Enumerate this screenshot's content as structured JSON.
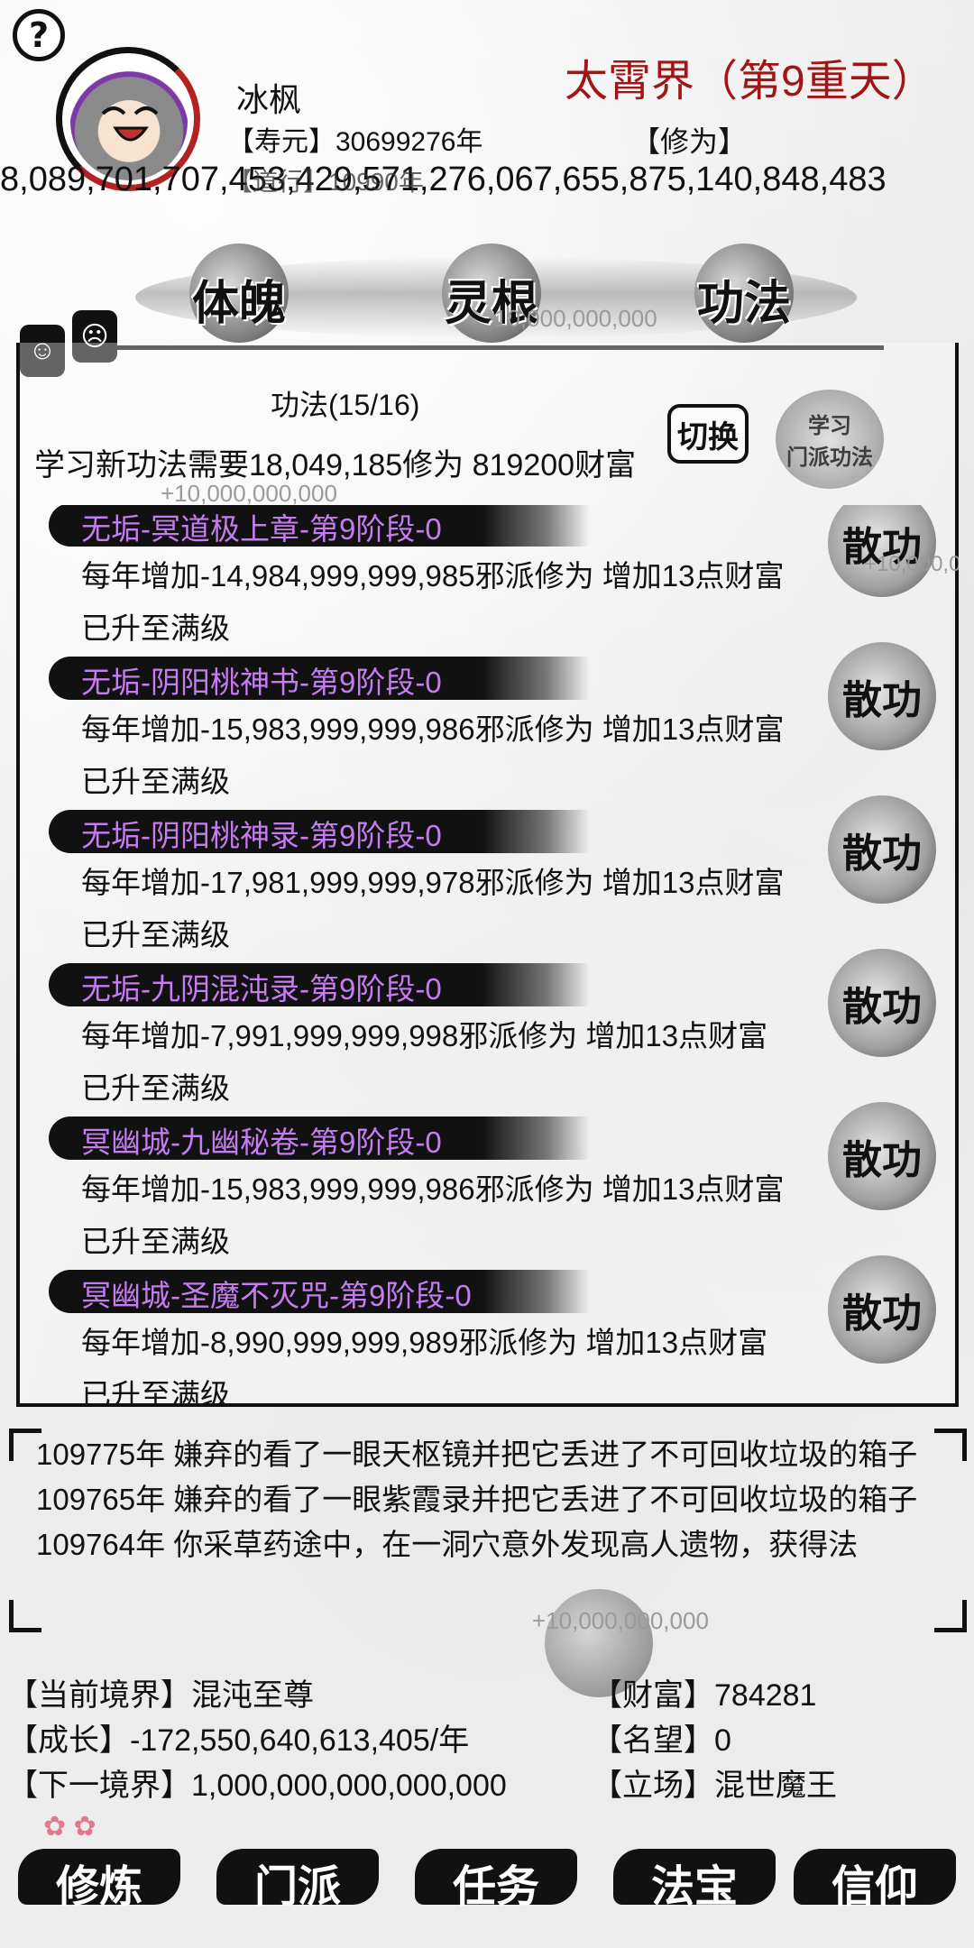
{
  "header": {
    "help_glyph": "?",
    "player_name": "冰枫",
    "lifespan": "【寿元】30699276年",
    "cultivation_label": "【修为】",
    "realm_world": "太霄界（第9重天）",
    "cultivation_value": "8,089,701,707,453,429,571,276,067,655,875,140,848,483",
    "dao_heart_overlay": "【道行】10990年"
  },
  "tabs": [
    {
      "label": "体魄"
    },
    {
      "label": "灵根"
    },
    {
      "label": "功法"
    }
  ],
  "faint_numbers": {
    "tab_bar": "10,000,000,000",
    "panel_top": "+10,000,000,000",
    "side": "+10,000,000",
    "log": "+10,000,000,000"
  },
  "panel": {
    "title": "功法(15/16)",
    "learn_requirement": "学习新功法需要18,049,185修为 819200财富",
    "switch_label": "切换",
    "learn_sect_label_1": "学习",
    "learn_sect_label_2": "门派功法",
    "side_faces": [
      "☺",
      "☹"
    ],
    "disperse_label": "散功"
  },
  "skills": [
    {
      "name": "无垢-冥道极上章-第9阶段-0",
      "effect": "每年增加-14,984,999,999,985邪派修为 增加13点财富",
      "status": "已升至满级"
    },
    {
      "name": "无垢-阴阳桃神书-第9阶段-0",
      "effect": "每年增加-15,983,999,999,986邪派修为 增加13点财富",
      "status": "已升至满级"
    },
    {
      "name": "无垢-阴阳桃神录-第9阶段-0",
      "effect": "每年增加-17,981,999,999,978邪派修为 增加13点财富",
      "status": "已升至满级"
    },
    {
      "name": "无垢-九阴混沌录-第9阶段-0",
      "effect": "每年增加-7,991,999,999,998邪派修为 增加13点财富",
      "status": "已升至满级"
    },
    {
      "name": "冥幽城-九幽秘卷-第9阶段-0",
      "effect": "每年增加-15,983,999,999,986邪派修为 增加13点财富",
      "status": "已升至满级"
    },
    {
      "name": "冥幽城-圣魔不灭咒-第9阶段-0",
      "effect": "每年增加-8,990,999,999,989邪派修为 增加13点财富",
      "status": "已升至满级"
    }
  ],
  "log": [
    "109775年 嫌弃的看了一眼天枢镜并把它丢进了不可回收垃圾的箱子",
    "109765年 嫌弃的看了一眼紫霞录并把它丢进了不可回收垃圾的箱子",
    "109764年 你采草药途中，在一洞穴意外发现高人遗物，获得法"
  ],
  "stats": {
    "realm": "【当前境界】混沌至尊",
    "growth": "【成长】-172,550,640,613,405/年",
    "next_realm": "【下一境界】1,000,000,000,000,000",
    "wealth": "【财富】784281",
    "fame": "【名望】0",
    "stance": "【立场】混世魔王"
  },
  "nav": [
    {
      "label": "修炼"
    },
    {
      "label": "门派"
    },
    {
      "label": "任务"
    },
    {
      "label": "法宝"
    },
    {
      "label": "信仰"
    }
  ],
  "colors": {
    "skill_name": "#c57cf0",
    "realm_world": "#a11515",
    "ink": "#111111"
  }
}
